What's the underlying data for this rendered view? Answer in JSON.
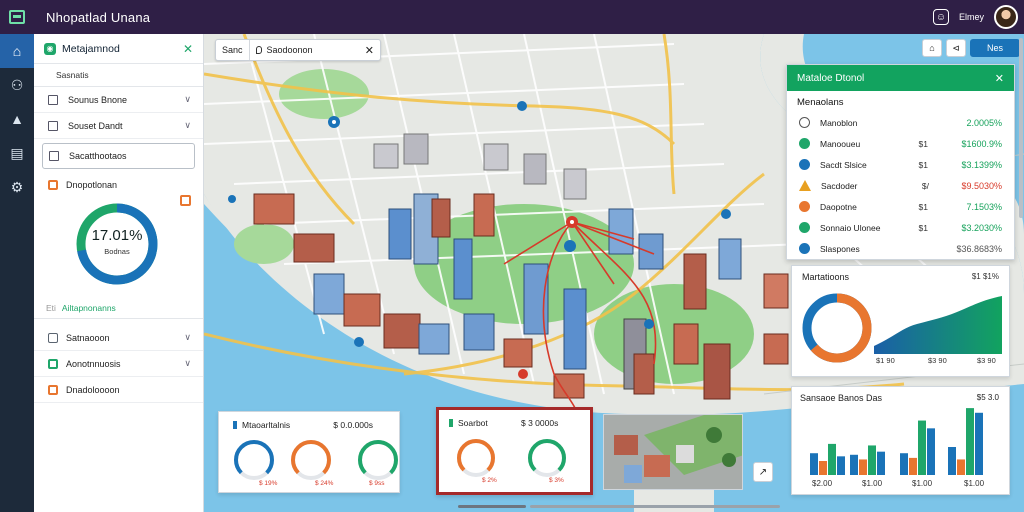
{
  "app": {
    "title": "Nhopatlad Unana"
  },
  "topbar": {
    "username": "Elmey",
    "user_icon_glyph": "☺"
  },
  "rail": {
    "icons": [
      "home-icon",
      "people-icon",
      "layers-icon",
      "database-icon",
      "settings-icon"
    ],
    "glyphs": [
      "⌂",
      "⚇",
      "▲",
      "▤",
      "⚙"
    ]
  },
  "left_panel": {
    "title": "Metajamnod",
    "subtitle": "Sasnatis",
    "filters": [
      {
        "label": "Sounus Bnone"
      },
      {
        "label": "Souset Dandt"
      }
    ],
    "selected_filter": "Sacatthootaos",
    "section_title": "Dnopotlonan",
    "gauge_percent": "17.01%",
    "gauge_value": 0.72,
    "gauge_label": "Bodnas",
    "stat_tag": "Eti",
    "stat_text": "Ailtapnonanns",
    "groups": [
      {
        "label": "Satnaooon"
      },
      {
        "label": "Aonotnnuosis"
      },
      {
        "label": "Dnadoloooon"
      }
    ]
  },
  "search": {
    "left_label": "Sanc",
    "value": "Saodoonon"
  },
  "toolbar": {
    "primary_label": "Nes",
    "btn1_glyph": "⌂",
    "btn2_glyph": "⊲"
  },
  "stats_card": {
    "title": "Mataloe Dtonol",
    "subtitle": "Menaolans",
    "rows": [
      {
        "icon": "circle-icon",
        "name": "Manoblon",
        "mid": "",
        "value": "2.0005%",
        "color": "#16a25b"
      },
      {
        "icon": "info-icon",
        "name": "Manooueu",
        "mid": "$1",
        "value": "$1600.9%",
        "color": "#16a25b"
      },
      {
        "icon": "vehicle-icon",
        "name": "Sacdt Slsice",
        "mid": "$1",
        "value": "$3.1399%",
        "color": "#16a25b"
      },
      {
        "icon": "warning-icon",
        "name": "Sacdoder",
        "mid": "$/",
        "value": "$9.5030%",
        "color": "#d83a2a"
      },
      {
        "icon": "battery-icon",
        "name": "Daopotne",
        "mid": "$1",
        "value": "7.1503%",
        "color": "#16a25b"
      },
      {
        "icon": "location-icon",
        "name": "Sonnaio Ulonee",
        "mid": "$1",
        "value": "$3.2030%",
        "color": "#16a25b"
      },
      {
        "icon": "gear-icon",
        "name": "Slaspones",
        "mid": "",
        "value": "$36.8683%",
        "color": "#555555"
      }
    ]
  },
  "trend_card": {
    "title": "Martatioons",
    "right_label": "$1 $1%",
    "axis_labels": [
      "$1 90",
      "$3 90",
      "$3 90"
    ]
  },
  "bar_card": {
    "title": "Sansaoe Banos Das",
    "right_label": "$5 3.0",
    "axis_labels": [
      "$2.00",
      "$1.00",
      "$1.00",
      "$1.00"
    ]
  },
  "chart_data": {
    "type": "bar",
    "categories": [
      "$2.00",
      "$1.00",
      "$1.00",
      "$1.00"
    ],
    "series": [
      {
        "values": [
          28,
          26,
          28,
          36
        ],
        "color": "#1a73b8"
      },
      {
        "values": [
          18,
          20,
          22,
          20
        ],
        "color": "#e8762f"
      },
      {
        "values": [
          40,
          38,
          70,
          86
        ],
        "color": "#1fa66a"
      },
      {
        "values": [
          24,
          30,
          60,
          80
        ],
        "color": "#1a73b8"
      }
    ]
  },
  "card_a": {
    "title": "Mtaoarltalnis",
    "right_label": "$ 0.0.000s",
    "gauges": [
      {
        "label": "$ 19%",
        "color": "#1a73b8"
      },
      {
        "label": "$ 24%",
        "color": "#e8762f"
      },
      {
        "label": "$ 9ss",
        "color": "#1fa66a"
      }
    ]
  },
  "card_b": {
    "title": "Soarbot",
    "right_label": "$ 3 0000s",
    "gauges": [
      {
        "label": "$ 2%",
        "color": "#e8762f"
      },
      {
        "label": "$ 3%",
        "color": "#1fa66a"
      }
    ]
  },
  "expand_glyph": "↗"
}
